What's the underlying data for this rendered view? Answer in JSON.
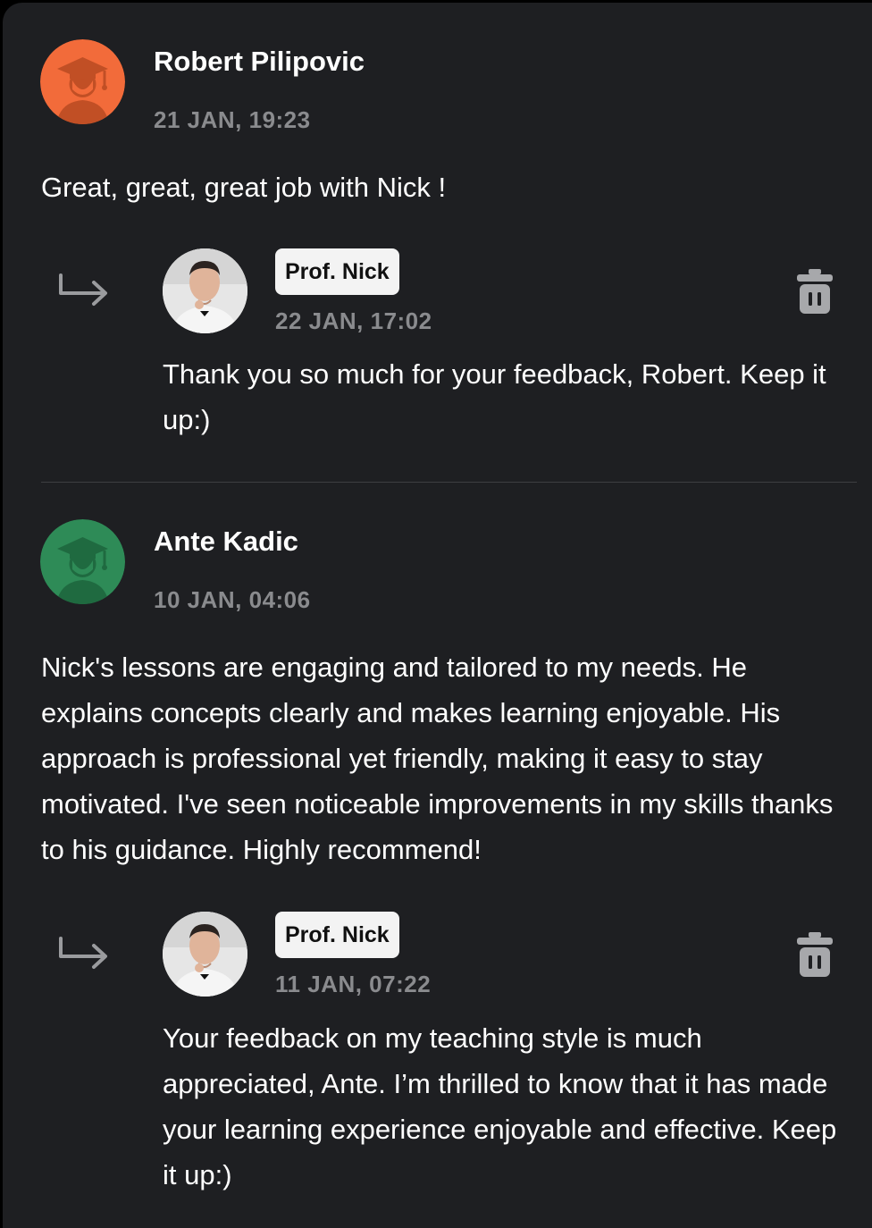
{
  "reviews": [
    {
      "author": "Robert Pilipovic",
      "date": "21 JAN, 19:23",
      "text": "Great, great, great job with Nick !",
      "avatar_color": "#f26b3a",
      "avatar_icon": "graduation-cap-icon",
      "reply": {
        "author_badge": "Prof. Nick",
        "date": "22 JAN, 17:02",
        "text": "Thank you so much for your feedback, Robert. Keep it up:)"
      }
    },
    {
      "author": "Ante Kadic",
      "date": "10 JAN, 04:06",
      "text": "Nick's lessons are engaging and tailored to my needs. He explains concepts clearly and makes learning enjoyable. His approach is professional yet friendly, making it easy to stay motivated. I've seen noticeable improvements in my skills thanks to his guidance. Highly recommend!",
      "avatar_color": "#2e8b57",
      "avatar_icon": "graduation-cap-icon",
      "reply": {
        "author_badge": "Prof. Nick",
        "date": "11 JAN, 07:22",
        "text": "Your feedback on my teaching style is much appreciated, Ante. I’m thrilled to know that it has made your learning experience enjoyable and effective. Keep it up:)"
      }
    }
  ]
}
